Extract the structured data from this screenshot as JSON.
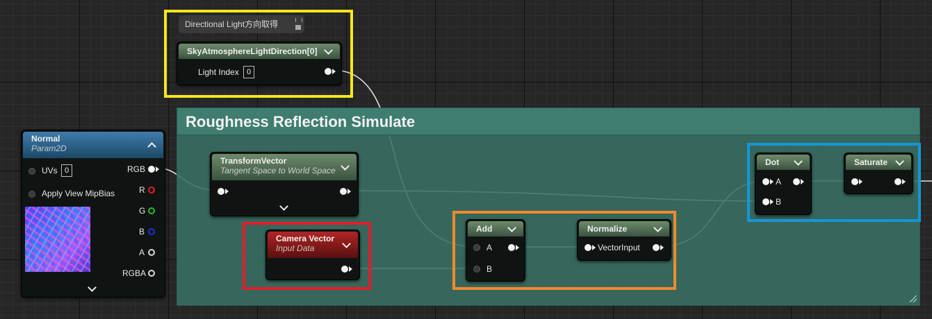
{
  "tooltip": {
    "text": "Directional Light方向取得"
  },
  "comment": {
    "title": "Roughness Reflection Simulate"
  },
  "nodes": {
    "sky_light": {
      "title": "SkyAtmosphereLightDirection[0]",
      "pin_label": "Light Index",
      "pin_value": "0"
    },
    "normal": {
      "title": "Normal",
      "subtitle": "Param2D",
      "uvs_label": "UVs",
      "uvs_value": "0",
      "mip_label": "Apply View MipBias",
      "outputs": [
        "RGB",
        "R",
        "G",
        "B",
        "A",
        "RGBA"
      ]
    },
    "transform": {
      "title": "TransformVector",
      "subtitle": "Tangent Space to World Space"
    },
    "camera": {
      "title": "Camera Vector",
      "subtitle": "Input Data"
    },
    "add": {
      "title": "Add",
      "in_a": "A",
      "in_b": "B"
    },
    "normalize": {
      "title": "Normalize",
      "in": "VectorInput"
    },
    "dot": {
      "title": "Dot",
      "in_a": "A",
      "in_b": "B"
    },
    "saturate": {
      "title": "Saturate"
    }
  },
  "colors": {
    "highlight_yellow": "#f5e71a",
    "highlight_red": "#e01f2b",
    "highlight_orange": "#f28a2c",
    "highlight_blue": "#1496d6",
    "pin_r": "#e02020",
    "pin_g": "#20c020",
    "pin_b": "#2030e0",
    "comment_bg": "#3f7d70"
  }
}
